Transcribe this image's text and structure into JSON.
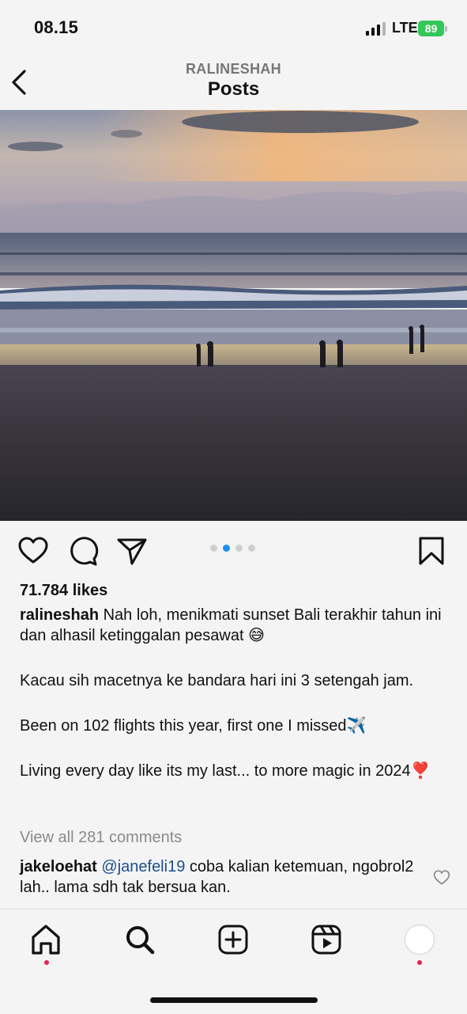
{
  "status_bar": {
    "time": "08.15",
    "network": "LTE",
    "battery": "89"
  },
  "header": {
    "username": "RALINESHAH",
    "title": "Posts"
  },
  "post": {
    "likes": "71.784 likes",
    "author": "ralineshah",
    "caption_line1": "Nah loh, menikmati sunset Bali terakhir tahun ini dan alhasil ketinggalan pesawat 😅",
    "caption_line2": "Kacau sih macetnya ke bandara hari ini 3 setengah jam.",
    "caption_line3": "Been on 102 flights this year, first one I missed✈️",
    "caption_line4": "Living every day like its my last... to more magic in 2024❣️",
    "view_comments": "View all 281 comments",
    "carousel_active_index": 1,
    "carousel_count": 4
  },
  "comment": {
    "user": "jakeloehat",
    "mention": "@janefeli19",
    "text": " coba kalian ketemuan, ngobrol2 lah.. lama sdh tak bersua kan."
  },
  "colors": {
    "accent": "#1c8df2",
    "notification": "#e6204f",
    "battery": "#34c759"
  }
}
